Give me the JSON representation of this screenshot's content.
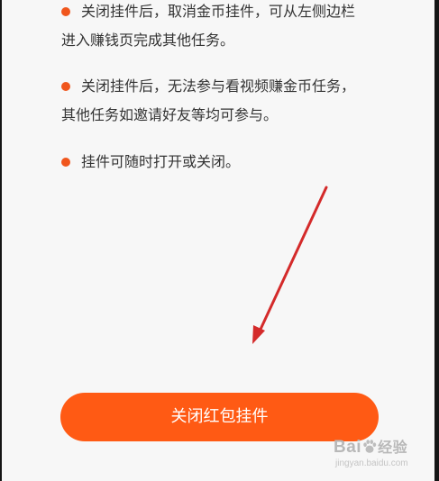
{
  "bullets": [
    {
      "line1": "关闭挂件后，取消金币挂件，可从左侧边栏",
      "line2": "进入赚钱页完成其他任务。"
    },
    {
      "line1": "关闭挂件后，无法参与看视频赚金币任务，",
      "line2": "其他任务如邀请好友等均可参与。"
    },
    {
      "line1": "挂件可随时打开或关闭。"
    }
  ],
  "button": {
    "label": "关闭红包挂件"
  },
  "watermark": {
    "logo_part1": "Bai",
    "logo_part2": "经验",
    "sub": "jingyan.baidu.com"
  },
  "colors": {
    "accent": "#ff5a14",
    "bullet_dot": "#f0561d",
    "arrow": "#d42a2a",
    "screen_bg": "#f7f7f7",
    "text": "#333333"
  },
  "icons": {
    "bullet": "orange-dot-icon",
    "annotation": "red-arrow-annotation",
    "watermark_logo": "baidu-paw-icon"
  }
}
